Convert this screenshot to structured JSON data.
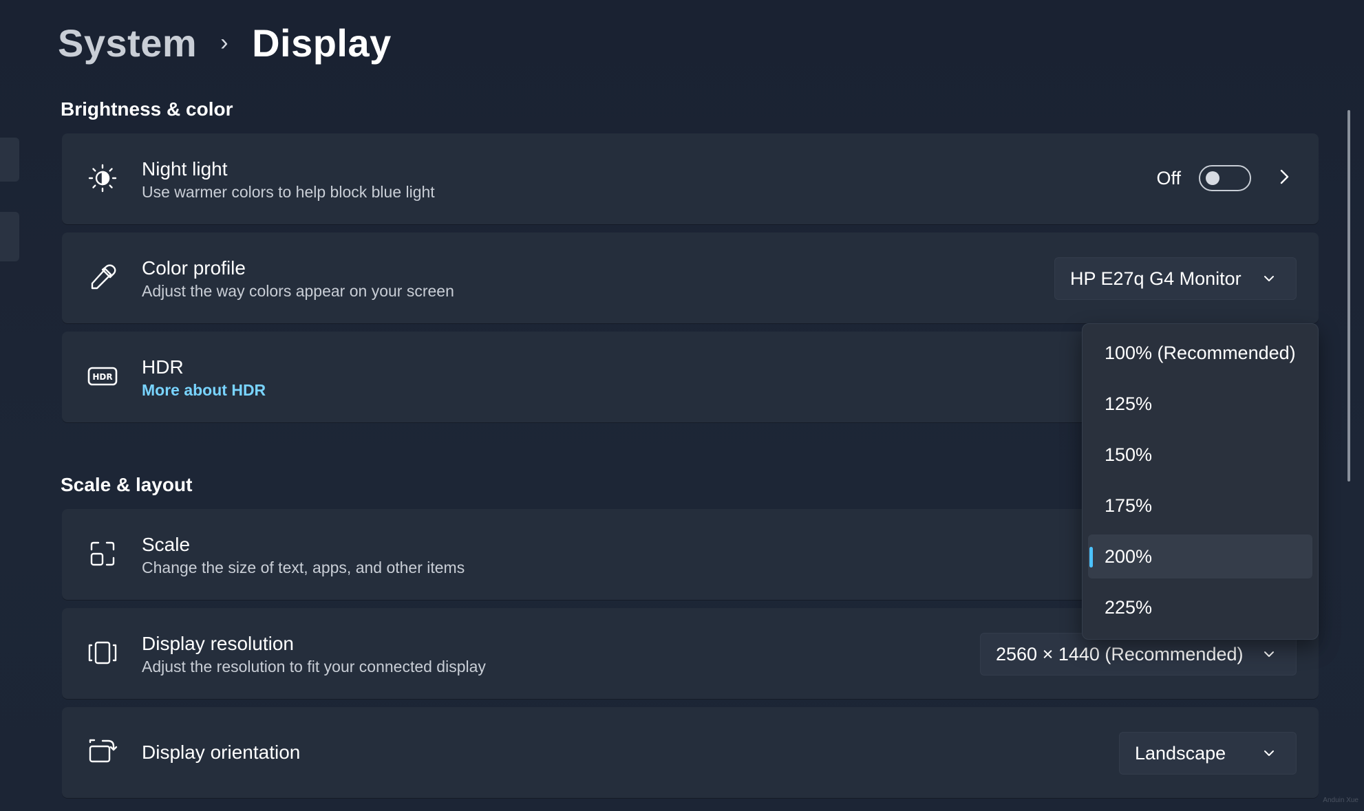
{
  "breadcrumb": {
    "parent": "System",
    "separator": "›",
    "current": "Display"
  },
  "sections": {
    "brightness": "Brightness & color",
    "scale_layout": "Scale & layout"
  },
  "night_light": {
    "title": "Night light",
    "subtitle": "Use warmer colors to help block blue light",
    "toggle_state": "Off",
    "icon": "sun-moon-icon"
  },
  "color_profile": {
    "title": "Color profile",
    "subtitle": "Adjust the way colors appear on your screen",
    "value": "HP E27q G4 Monitor",
    "icon": "eyedropper-icon"
  },
  "hdr": {
    "title": "HDR",
    "link": "More about HDR",
    "icon": "hdr-icon"
  },
  "scale": {
    "title": "Scale",
    "subtitle": "Change the size of text, apps, and other items",
    "icon": "scale-icon",
    "options": [
      "100% (Recommended)",
      "125%",
      "150%",
      "175%",
      "200%",
      "225%"
    ],
    "selected": "200%"
  },
  "resolution": {
    "title": "Display resolution",
    "subtitle": "Adjust the resolution to fit your connected display",
    "value": "2560 × 1440 (Recommended)",
    "icon": "resolution-icon"
  },
  "orientation": {
    "title": "Display orientation",
    "value": "Landscape",
    "icon": "rotate-display-icon"
  },
  "watermark": "Anduin Xue",
  "colors": {
    "background": "#1b2433",
    "card": "#252e3c",
    "accent": "#4cc2ff",
    "link": "#79d4ff"
  }
}
